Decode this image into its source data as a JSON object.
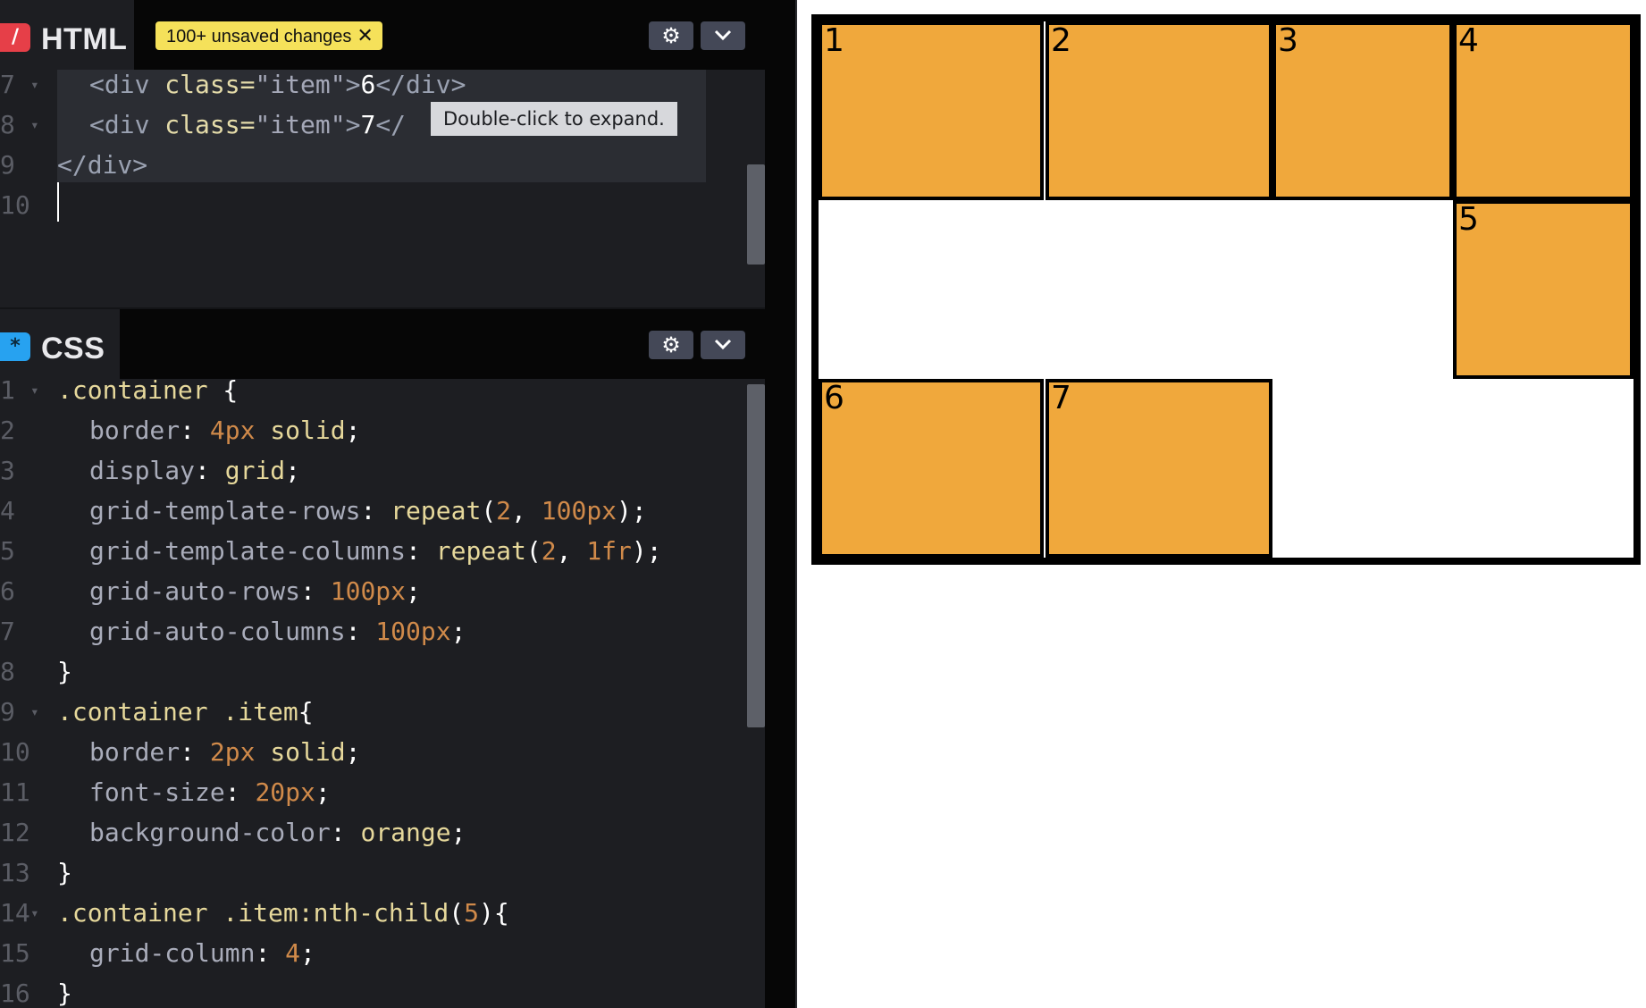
{
  "html_pane": {
    "icon_glyph": "/",
    "icon_name": "html-slash-icon",
    "title": "HTML",
    "unsaved_badge": "100+ unsaved changes",
    "badge_close_glyph": "✕",
    "tooltip": "Double-click to expand.",
    "line_numbers": [
      "7",
      "8",
      "9",
      "10"
    ],
    "lines": {
      "l7": {
        "open_tag": "<div ",
        "attr": "class=",
        "attr_val": "\"item\"",
        "tag_end": ">",
        "text": "6",
        "close_tag": "</div>"
      },
      "l8": {
        "open_tag": "<div ",
        "attr": "class=",
        "attr_val": "\"item\"",
        "tag_end": ">",
        "text": "7",
        "close_tag": "</"
      },
      "l9": {
        "close_tag": "</div>"
      }
    }
  },
  "css_pane": {
    "icon_glyph": "*",
    "icon_name": "css-asterisk-icon",
    "title": "CSS",
    "line_numbers": [
      "1",
      "2",
      "3",
      "4",
      "5",
      "6",
      "7",
      "8",
      "9",
      "10",
      "11",
      "12",
      "13",
      "14",
      "15",
      "16"
    ],
    "code": {
      "l1_sel": ".container",
      "l2_prop": "border",
      "l2_num": "4px",
      "l2_val": "solid",
      "l3_prop": "display",
      "l3_val": "grid",
      "l4_prop": "grid-template-rows",
      "l4_fn": "repeat",
      "l4_a": "2",
      "l4_b": "100px",
      "l5_prop": "grid-template-columns",
      "l5_fn": "repeat",
      "l5_a": "2",
      "l5_b": "1fr",
      "l6_prop": "grid-auto-rows",
      "l6_num": "100px",
      "l7_prop": "grid-auto-columns",
      "l7_num": "100px",
      "l9_sel": ".container .item",
      "l10_prop": "border",
      "l10_num": "2px",
      "l10_val": "solid",
      "l11_prop": "font-size",
      "l11_num": "20px",
      "l12_prop": "background-color",
      "l12_val": "orange",
      "l14_sel": ".container .item:nth-child",
      "l14_arg": "5",
      "l15_prop": "grid-column",
      "l15_num": "4"
    }
  },
  "preview": {
    "items": [
      "1",
      "2",
      "3",
      "4",
      "5",
      "6",
      "7"
    ]
  },
  "icons": {
    "settings": "gear-icon",
    "collapse": "chevron-down-icon"
  },
  "colors": {
    "item_bg": "#f0a83c",
    "badge_bg": "#f5e15a",
    "html_icon": "#e63f48",
    "css_icon": "#27a2f0"
  }
}
